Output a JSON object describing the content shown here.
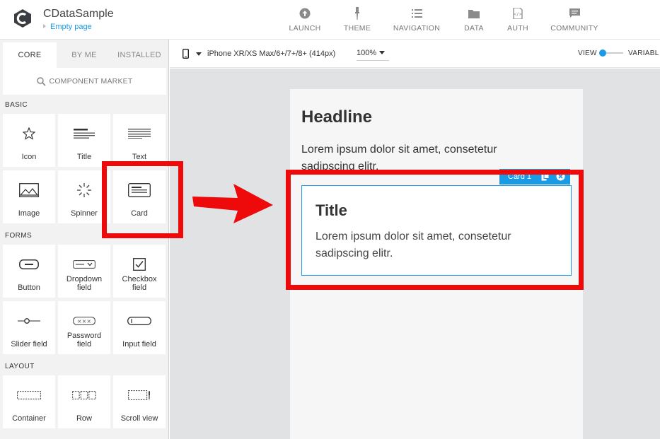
{
  "app": {
    "title": "CDataSample",
    "page": "Empty page"
  },
  "nav": [
    {
      "label": "LAUNCH",
      "icon": "launch-icon"
    },
    {
      "label": "THEME",
      "icon": "theme-icon"
    },
    {
      "label": "NAVIGATION",
      "icon": "navigation-icon"
    },
    {
      "label": "DATA",
      "icon": "folder-icon"
    },
    {
      "label": "AUTH",
      "icon": "auth-icon"
    },
    {
      "label": "COMMUNITY",
      "icon": "community-icon"
    }
  ],
  "tabs": {
    "core": "CORE",
    "by_me": "BY ME",
    "installed": "INSTALLED"
  },
  "market": "COMPONENT MARKET",
  "sections": {
    "basic": "BASIC",
    "forms": "FORMS",
    "layout": "LAYOUT"
  },
  "tiles": {
    "icon": "Icon",
    "title": "Title",
    "text": "Text",
    "image": "Image",
    "spinner": "Spinner",
    "card": "Card",
    "button": "Button",
    "dropdown": "Dropdown field",
    "checkbox": "Checkbox field",
    "slider": "Slider field",
    "password": "Password field",
    "input": "Input field",
    "container": "Container",
    "row": "Row",
    "scroll": "Scroll view"
  },
  "toolbar": {
    "device": "iPhone XR/XS Max/6+/7+/8+ (414px)",
    "zoom": "100%",
    "view": "VIEW",
    "variables": "VARIABL"
  },
  "canvas": {
    "headline": "Headline",
    "lorem": "Lorem ipsum dolor sit amet, consetetur sadipscing elitr.",
    "card_badge": "Card 1",
    "card_title": "Title",
    "card_text": "Lorem ipsum dolor sit amet, consetetur sadipscing elitr."
  },
  "colors": {
    "accent": "#1a9be6",
    "highlight": "#ee0a0a"
  }
}
